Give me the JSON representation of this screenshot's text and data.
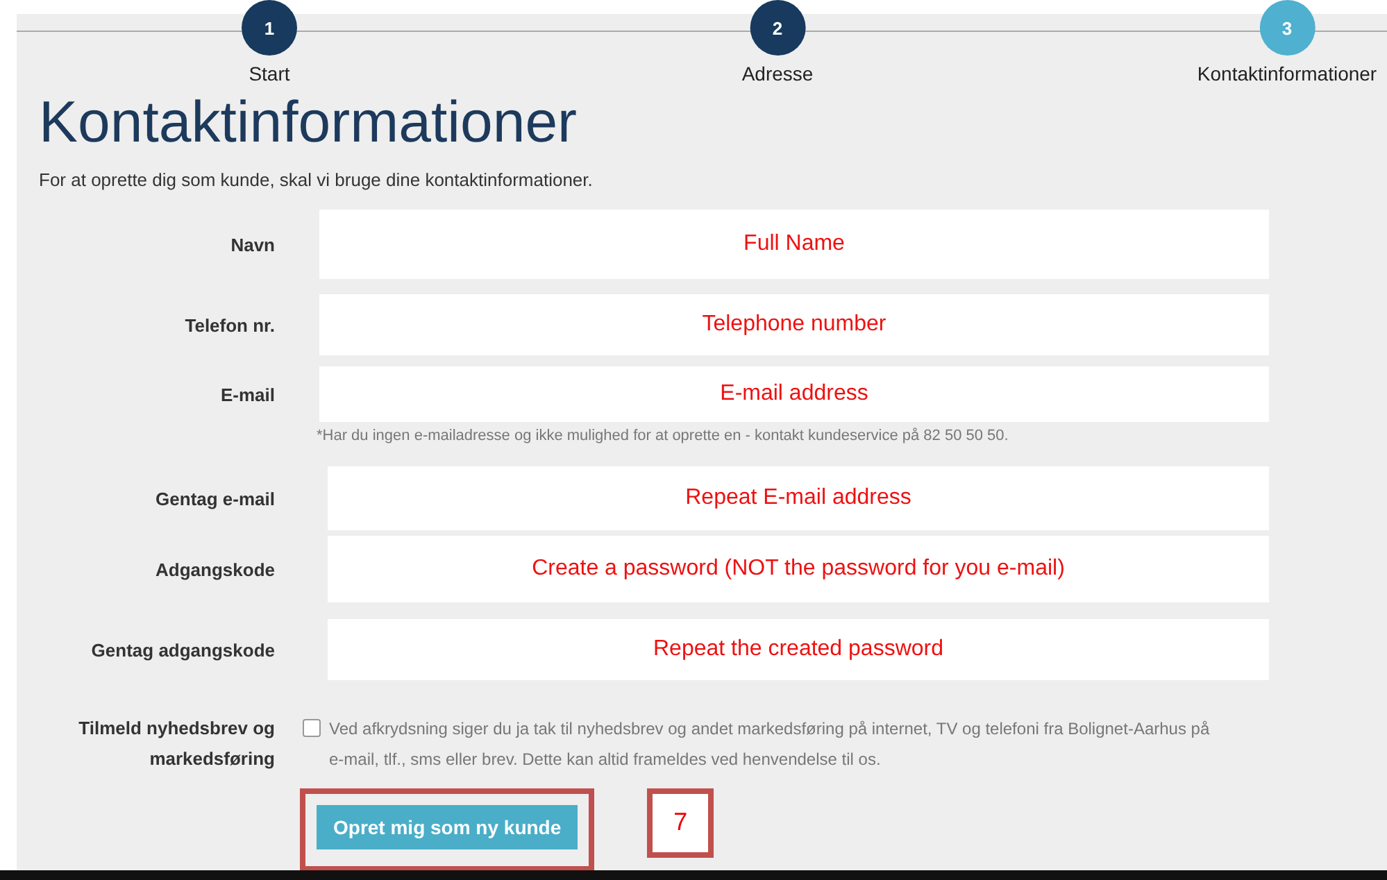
{
  "steps": [
    {
      "number": "1",
      "label": "Start",
      "selected": false
    },
    {
      "number": "2",
      "label": "Adresse",
      "selected": false
    },
    {
      "number": "3",
      "label": "Kontaktinformationer",
      "selected": true
    }
  ],
  "title": "Kontaktinformationer",
  "intro": "For at oprette dig som kunde, skal vi bruge dine kontaktinformationer.",
  "fields": [
    {
      "label": "Navn",
      "value": "Full Name"
    },
    {
      "label": "Telefon nr.",
      "value": "Telephone number"
    },
    {
      "label": "E-mail",
      "value": "E-mail address",
      "note": "*Har du ingen e-mailadresse og ikke mulighed for at oprette en - kontakt kundeservice på 82 50 50 50."
    },
    {
      "label": "Gentag e-mail",
      "value": "Repeat E-mail address"
    },
    {
      "label": "Adgangskode",
      "value": "Create a password (NOT the password for you e-mail)"
    },
    {
      "label": "Gentag adgangskode",
      "value": "Repeat the created password"
    }
  ],
  "newsletter": {
    "label": "Tilmeld nyhedsbrev og markedsføring",
    "checked": false,
    "text": "Ved afkrydsning siger du ja tak til nyhedsbrev og andet markedsføring på internet, TV og telefoni fra Bolignet-Aarhus på e-mail, tlf., sms eller brev. Dette kan altid frameldes ved henvendelse til os."
  },
  "submit": "Opret mig som ny kunde",
  "callout": "7"
}
